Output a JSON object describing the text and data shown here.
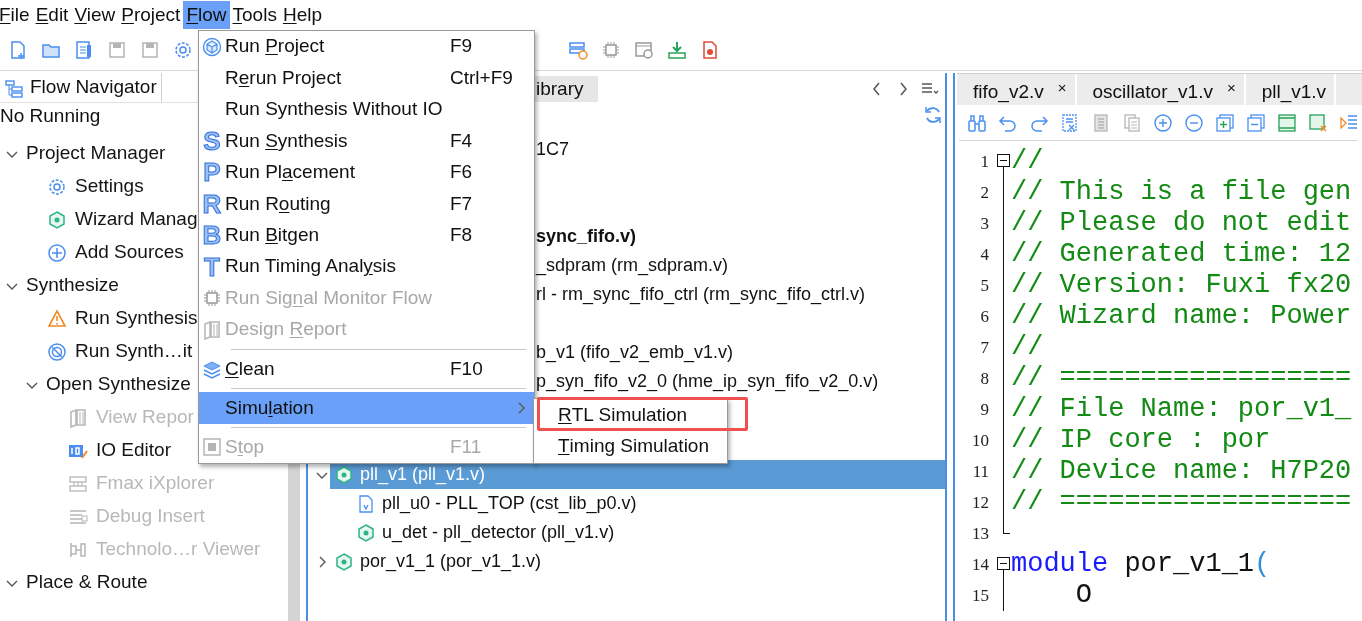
{
  "menu_bar": [
    {
      "key": "F",
      "post": "ile",
      "selected": false
    },
    {
      "key": "E",
      "post": "dit",
      "selected": false
    },
    {
      "key": "V",
      "post": "iew",
      "selected": false
    },
    {
      "key": "P",
      "post": "roject",
      "selected": false
    },
    {
      "key": "F",
      "post": "low",
      "selected": true
    },
    {
      "key": "T",
      "post": "ools",
      "selected": false
    },
    {
      "key": "H",
      "post": "elp",
      "selected": false
    }
  ],
  "flow_menu": [
    {
      "kind": "item",
      "pre": "Run ",
      "key": "P",
      "post": "roject",
      "shortcut": "F9",
      "disabled": false,
      "selected": false
    },
    {
      "kind": "item",
      "pre": "R",
      "key": "e",
      "post": "run Project",
      "shortcut": "Ctrl+F9",
      "disabled": false,
      "selected": false
    },
    {
      "kind": "item",
      "pre": "Run Synthesis Without IO",
      "disabled": false,
      "selected": false
    },
    {
      "kind": "item",
      "icon_letter": "S",
      "pre": "Run ",
      "key": "S",
      "post": "ynthesis",
      "shortcut": "F4",
      "disabled": false,
      "selected": false
    },
    {
      "kind": "item",
      "icon_letter": "P",
      "pre": "Run Pl",
      "key": "a",
      "post": "cement",
      "shortcut": "F6",
      "disabled": false,
      "selected": false
    },
    {
      "kind": "item",
      "icon_letter": "R",
      "pre": "Run R",
      "key": "o",
      "post": "uting",
      "shortcut": "F7",
      "disabled": false,
      "selected": false
    },
    {
      "kind": "item",
      "icon_letter": "B",
      "pre": "Run ",
      "key": "B",
      "post": "itgen",
      "shortcut": "F8",
      "disabled": false,
      "selected": false
    },
    {
      "kind": "item",
      "icon_letter": "T",
      "pre": "Run Timing Anal",
      "key": "y",
      "post": "sis",
      "disabled": false,
      "selected": false
    },
    {
      "kind": "item",
      "pre": "Run Sig",
      "key": "n",
      "post": "al Monitor Flow",
      "disabled": true,
      "selected": false
    },
    {
      "kind": "item",
      "pre": "Design ",
      "key": "R",
      "post": "eport",
      "disabled": true,
      "selected": false
    },
    {
      "kind": "separator"
    },
    {
      "kind": "item",
      "key": "C",
      "post": "lean",
      "shortcut": "F10",
      "disabled": false,
      "selected": false
    },
    {
      "kind": "separator"
    },
    {
      "kind": "submenu",
      "pre": "Simu",
      "key": "l",
      "post": "ation",
      "disabled": false,
      "selected": true
    },
    {
      "kind": "separator"
    },
    {
      "kind": "item",
      "pre": "S",
      "key": "t",
      "post": "op",
      "shortcut": "F11",
      "disabled": true,
      "selected": false
    }
  ],
  "simulation_submenu": [
    {
      "key": "R",
      "post": "TL Simulation",
      "highlighted": true
    },
    {
      "key": "T",
      "post": "iming Simulation",
      "highlighted": false
    }
  ],
  "flow_navigator": {
    "title": "Flow Navigator",
    "status": "No Running",
    "sections": [
      {
        "label": "Project Manager",
        "expanded": true,
        "children": [
          {
            "label": "Settings",
            "disabled": false
          },
          {
            "label": "Wizard Manag",
            "disabled": false
          },
          {
            "label": "Add Sources",
            "disabled": false
          }
        ]
      },
      {
        "label": "Synthesize",
        "expanded": true,
        "children": [
          {
            "label": "Run Synthesis",
            "disabled": false
          },
          {
            "label": "Run Synth…it",
            "disabled": false
          },
          {
            "label": "Open Synthesize",
            "expanded": true,
            "disabled": false,
            "children": [
              {
                "label": "View Repor",
                "disabled": true
              },
              {
                "label": "IO Editor",
                "disabled": false
              },
              {
                "label": "Fmax iXplorer",
                "disabled": true
              },
              {
                "label": "Debug Insert",
                "disabled": true
              },
              {
                "label": "Technolo…r Viewer",
                "disabled": true
              }
            ]
          }
        ]
      },
      {
        "label": "Place & Route",
        "expanded": true
      }
    ]
  },
  "hierarchy": {
    "tab": "ibrary",
    "rows": [
      {
        "kind": "partial",
        "text": "1C7",
        "selected": false
      },
      {
        "kind": "top",
        "text": "sync_fifo.v)",
        "selected": false
      },
      {
        "kind": "partial",
        "text": "_sdpram (rm_sdpram.v)",
        "selected": false
      },
      {
        "kind": "partial",
        "text": "rl - rm_sync_fifo_ctrl (rm_sync_fifo_ctrl.v)",
        "selected": false
      },
      {
        "kind": "partial",
        "text": "b_v1 (fifo_v2_emb_v1.v)",
        "selected": false
      },
      {
        "kind": "partial",
        "text": "p_syn_fifo_v2_0 (hme_ip_syn_fifo_v2_0.v)",
        "selected": false
      },
      {
        "kind": "module",
        "text": "pll_v1 (pll_v1.v)",
        "expanded": true,
        "selected": true
      },
      {
        "kind": "child",
        "text": "pll_u0 - PLL_TOP (cst_lib_p0.v)",
        "selected": false
      },
      {
        "kind": "child",
        "text": "u_det - pll_detector (pll_v1.v)",
        "selected": false
      },
      {
        "kind": "module",
        "text": "por_v1_1 (por_v1_1.v)",
        "expanded": false,
        "selected": false
      }
    ]
  },
  "editor": {
    "tabs": [
      {
        "label": "fifo_v2.v",
        "close": "×"
      },
      {
        "label": "oscillator_v1.v",
        "close": "×"
      },
      {
        "label": "pll_v1.v"
      }
    ],
    "lines": [
      {
        "number": "1",
        "kind": "start",
        "segments": [
          {
            "kind": "comment",
            "text": "//"
          }
        ]
      },
      {
        "number": "2",
        "kind": "inside",
        "segments": [
          {
            "kind": "comment",
            "text": "// This is a file gen"
          }
        ]
      },
      {
        "number": "3",
        "kind": "inside",
        "segments": [
          {
            "kind": "comment",
            "text": "// Please do not edit"
          }
        ]
      },
      {
        "number": "4",
        "kind": "inside",
        "segments": [
          {
            "kind": "comment",
            "text": "// Generated time: 12"
          }
        ]
      },
      {
        "number": "5",
        "kind": "inside",
        "segments": [
          {
            "kind": "comment",
            "text": "// Version: Fuxi fx20"
          }
        ]
      },
      {
        "number": "6",
        "kind": "inside",
        "segments": [
          {
            "kind": "comment",
            "text": "// Wizard name: Power"
          }
        ]
      },
      {
        "number": "7",
        "kind": "inside",
        "segments": [
          {
            "kind": "comment",
            "text": "//"
          }
        ]
      },
      {
        "number": "8",
        "kind": "inside",
        "segments": [
          {
            "kind": "comment",
            "text": "// =================="
          }
        ]
      },
      {
        "number": "9",
        "kind": "inside",
        "segments": [
          {
            "kind": "comment",
            "text": "// File Name: por_v1_"
          }
        ]
      },
      {
        "number": "10",
        "kind": "inside",
        "segments": [
          {
            "kind": "comment",
            "text": "// IP core : por"
          }
        ]
      },
      {
        "number": "11",
        "kind": "inside",
        "segments": [
          {
            "kind": "comment",
            "text": "// Device name: H7P20"
          }
        ]
      },
      {
        "number": "12",
        "kind": "inside",
        "segments": [
          {
            "kind": "comment",
            "text": "// =================="
          }
        ]
      },
      {
        "number": "13",
        "kind": "end"
      },
      {
        "number": "14",
        "kind": "start",
        "segments": [
          {
            "kind": "keyword",
            "text": "module"
          },
          {
            "kind": "plain",
            "text": " por_v1_1"
          },
          {
            "kind": "punct",
            "text": "("
          }
        ]
      },
      {
        "number": "15",
        "kind": "inside",
        "segments": [
          {
            "kind": "plain",
            "text": "    O"
          }
        ]
      }
    ]
  }
}
